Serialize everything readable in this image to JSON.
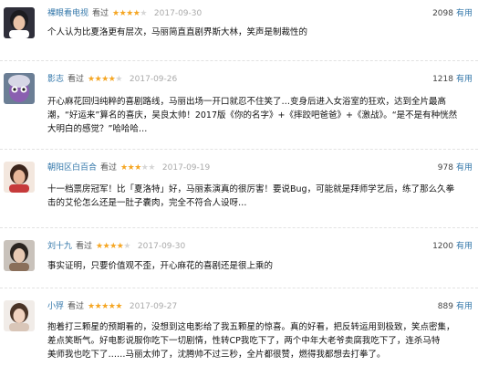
{
  "reviews": [
    {
      "user": "裸眼看电视",
      "watched": "看过",
      "rating": 4,
      "date": "2017-09-30",
      "votes": "2098",
      "useful": "有用",
      "lines": [
        "个人认为比夏洛更有层次，马丽简直直剧界斯大林，笑声是制裁性的"
      ],
      "avatar_colors": {
        "bg": "#2f2f3a",
        "skin": "#e9c3a8",
        "hair": "#1c1c20",
        "shirt": "#ffffff"
      }
    },
    {
      "user": "影志",
      "watched": "看过",
      "rating": 4,
      "date": "2017-09-26",
      "votes": "1218",
      "useful": "有用",
      "lines": [
        "开心麻花回归纯粹的喜剧路线，马丽出场一开口就忍不住笑了…变身后进入女浴室的狂欢，达到全片最高",
        "潮，“好运来”算名的喜庆，吴良太帅！2017版《你的名字》+《摔跤吧爸爸》+《激战》。“是不是有种恍然",
        "大明白的感觉？”哈哈哈…"
      ],
      "avatar_colors": {
        "bg": "#6b7e95",
        "skin": "#8a5fb0",
        "hair": "#d7d7e6",
        "shirt": "#4a3a70"
      }
    },
    {
      "user": "朝阳区白百合",
      "watched": "看过",
      "rating": 3,
      "date": "2017-09-19",
      "votes": "978",
      "useful": "有用",
      "lines": [
        "十一档票房冠军！比「夏洛特」好，马丽素演真的很厉害！要说Bug，可能就是拜师学艺后，练了那么久拳",
        "击的艾伦怎么还是一肚子囊肉，完全不符合人设呀…"
      ],
      "avatar_colors": {
        "bg": "#f3e7de",
        "skin": "#e8b79a",
        "hair": "#3a241b",
        "shirt": "#c63a3a"
      }
    },
    {
      "user": "刘十九",
      "watched": "看过",
      "rating": 4,
      "date": "2017-09-30",
      "votes": "1200",
      "useful": "有用",
      "lines": [
        "事实证明，只要价值观不歪，开心麻花的喜剧还是很上乘的"
      ],
      "avatar_colors": {
        "bg": "#c9c2bb",
        "skin": "#e7c9b3",
        "hair": "#2a2420",
        "shirt": "#8a6f5a"
      }
    },
    {
      "user": "小殍",
      "watched": "看过",
      "rating": 5,
      "date": "2017-09-27",
      "votes": "889",
      "useful": "有用",
      "lines": [
        "抱着打三颗星的预期看的，没想到这电影给了我五颗星的惊喜。真的好看，把反转运用到极致，笑点密集，",
        "差点笑断气。好电影说服你吃下一切剧情，性转CP我吃下了，两个中年大老爷卖腐我吃下了，连杀马特",
        "美师我也吃下了……马丽太帅了，沈腾帅不过三秒，全片都很赞，燃得我都想去打拳了。"
      ],
      "avatar_colors": {
        "bg": "#f1ece8",
        "skin": "#f1d3c0",
        "hair": "#4a3427",
        "shirt": "#d9c6b8"
      }
    }
  ]
}
